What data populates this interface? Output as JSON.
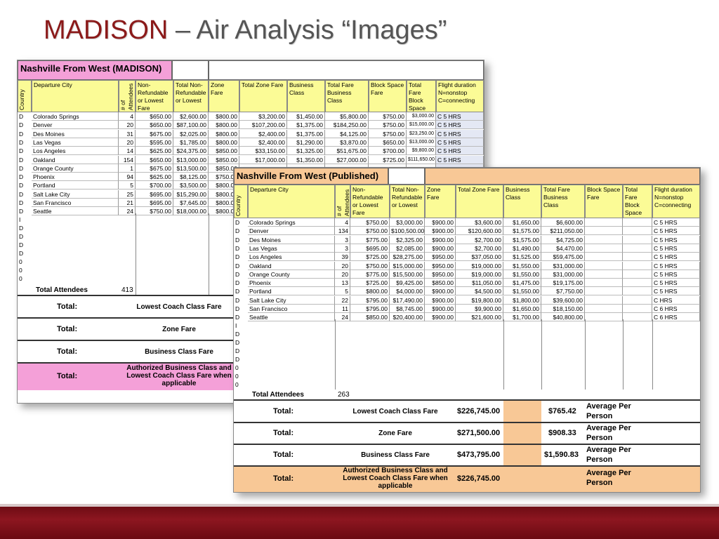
{
  "slide": {
    "title_highlight": "MADISON",
    "title_rest": " – Air Analysis “Images”"
  },
  "colors": {
    "title_red": "#8B1A1A",
    "pink": "#f4a0d8",
    "orange": "#f8c896",
    "yellow": "#fbfb96",
    "bar": "#7a1018"
  },
  "sheet1": {
    "title": "Nashville From West (MADISON)",
    "headers": {
      "country": "Country",
      "departure": "Departure City",
      "attendees": "# of Attendees",
      "nonref": "Non-Refundable or Lowest Fare",
      "total_nonref": "Total Non-Refundable or Lowest",
      "zone": "Zone Fare",
      "total_zone": "Total Zone Fare",
      "business": "Business Class",
      "total_business": "Total Fare Business Class",
      "block": "Block Space Fare",
      "total_block": "Total Fare Block Space",
      "flight": "Flight duration N=nonstop C=connecting"
    },
    "rows": [
      {
        "c": "D",
        "city": "Colorado Springs",
        "att": "4",
        "nr": "$650.00",
        "tnr": "$2,600.00",
        "zf": "$800.00",
        "tzf": "$3,200.00",
        "bc": "$1,450.00",
        "tbc": "$5,800.00",
        "bs": "$750.00",
        "tbs": "$3,000.00",
        "fd": "C 5 HRS"
      },
      {
        "c": "D",
        "city": "Denver",
        "att": "20",
        "nr": "$650.00",
        "tnr": "$87,100.00",
        "zf": "$800.00",
        "tzf": "$107,200.00",
        "bc": "$1,375.00",
        "tbc": "$184,250.00",
        "bs": "$750.00",
        "tbs": "$15,000.00",
        "fd": "C 5 HRS"
      },
      {
        "c": "D",
        "city": "Des Moines",
        "att": "31",
        "nr": "$675.00",
        "tnr": "$2,025.00",
        "zf": "$800.00",
        "tzf": "$2,400.00",
        "bc": "$1,375.00",
        "tbc": "$4,125.00",
        "bs": "$750.00",
        "tbs": "$23,250.00",
        "fd": "C 5 HRS"
      },
      {
        "c": "D",
        "city": "Las Vegas",
        "att": "20",
        "nr": "$595.00",
        "tnr": "$1,785.00",
        "zf": "$800.00",
        "tzf": "$2,400.00",
        "bc": "$1,290.00",
        "tbc": "$3,870.00",
        "bs": "$650.00",
        "tbs": "$13,000.00",
        "fd": "C 5 HRS"
      },
      {
        "c": "D",
        "city": "Los Angeles",
        "att": "14",
        "nr": "$625.00",
        "tnr": "$24,375.00",
        "zf": "$850.00",
        "tzf": "$33,150.00",
        "bc": "$1,325.00",
        "tbc": "$51,675.00",
        "bs": "$700.00",
        "tbs": "$9,800.00",
        "fd": "C 5 HRS"
      },
      {
        "c": "D",
        "city": "Oakland",
        "att": "154",
        "nr": "$650.00",
        "tnr": "$13,000.00",
        "zf": "$850.00",
        "tzf": "$17,000.00",
        "bc": "$1,350.00",
        "tbc": "$27,000.00",
        "bs": "$725.00",
        "tbs": "$111,650.00",
        "fd": "C 5 HRS"
      },
      {
        "c": "D",
        "city": "Orange County",
        "att": "1",
        "nr": "$675.00",
        "tnr": "$13,500.00",
        "zf": "$850.00",
        "tzf": "",
        "bc": "",
        "tbc": "",
        "bs": "",
        "tbs": "",
        "fd": ""
      },
      {
        "c": "D",
        "city": "Phoenix",
        "att": "94",
        "nr": "$625.00",
        "tnr": "$8,125.00",
        "zf": "$750.00",
        "tzf": "",
        "bc": "",
        "tbc": "",
        "bs": "",
        "tbs": "",
        "fd": ""
      },
      {
        "c": "D",
        "city": "Portland",
        "att": "5",
        "nr": "$700.00",
        "tnr": "$3,500.00",
        "zf": "$800.00",
        "tzf": "",
        "bc": "",
        "tbc": "",
        "bs": "",
        "tbs": "",
        "fd": ""
      },
      {
        "c": "D",
        "city": "Salt Lake City",
        "att": "25",
        "nr": "$695.00",
        "tnr": "$15,290.00",
        "zf": "$800.00",
        "tzf": "",
        "bc": "",
        "tbc": "",
        "bs": "",
        "tbs": "",
        "fd": ""
      },
      {
        "c": "D",
        "city": "San Francisco",
        "att": "21",
        "nr": "$695.00",
        "tnr": "$7,645.00",
        "zf": "$800.00",
        "tzf": "",
        "bc": "",
        "tbc": "",
        "bs": "",
        "tbs": "",
        "fd": ""
      },
      {
        "c": "D",
        "city": "Seattle",
        "att": "24",
        "nr": "$750.00",
        "tnr": "$18,000.00",
        "zf": "$800.00",
        "tzf": "",
        "bc": "",
        "tbc": "",
        "bs": "",
        "tbs": "",
        "fd": ""
      }
    ],
    "extra_flags": [
      "I",
      "D",
      "D",
      "D",
      "D",
      "0",
      "0",
      "0"
    ],
    "total_attendees_label": "Total Attendees",
    "total_attendees": "413",
    "totals": [
      {
        "label": "Total:",
        "desc": "Lowest Coach Class Fare"
      },
      {
        "label": "Total:",
        "desc": "Zone Fare"
      },
      {
        "label": "Total:",
        "desc": "Business Class Fare"
      },
      {
        "label": "Total:",
        "desc": "Authorized Business Class and Lowest Coach Class Fare when applicable"
      }
    ]
  },
  "sheet2": {
    "title": "Nashville From West (Published)",
    "headers": {
      "country": "Country",
      "departure": "Departure City",
      "attendees": "# of Attendees",
      "nonref": "Non-Refundable or Lowest Fare",
      "total_nonref": "Total Non-Refundable or Lowest",
      "zone": "Zone Fare",
      "total_zone": "Total Zone Fare",
      "business": "Business Class",
      "total_business": "Total Fare Business Class",
      "block": "Block Space Fare",
      "total_block": "Total Fare Block Space",
      "flight": "Flight duration N=nonstop C=connecting"
    },
    "rows": [
      {
        "c": "D",
        "city": "Colorado Springs",
        "att": "4",
        "nr": "$750.00",
        "tnr": "$3,000.00",
        "zf": "$900.00",
        "tzf": "$3,600.00",
        "bc": "$1,650.00",
        "tbc": "$6,600.00",
        "fd": "C 5 HRS"
      },
      {
        "c": "D",
        "city": "Denver",
        "att": "134",
        "nr": "$750.00",
        "tnr": "$100,500.00",
        "zf": "$900.00",
        "tzf": "$120,600.00",
        "bc": "$1,575.00",
        "tbc": "$211,050.00",
        "fd": "C 5 HRS"
      },
      {
        "c": "D",
        "city": "Des Moines",
        "att": "3",
        "nr": "$775.00",
        "tnr": "$2,325.00",
        "zf": "$900.00",
        "tzf": "$2,700.00",
        "bc": "$1,575.00",
        "tbc": "$4,725.00",
        "fd": "C 5 HRS"
      },
      {
        "c": "D",
        "city": "Las Vegas",
        "att": "3",
        "nr": "$695.00",
        "tnr": "$2,085.00",
        "zf": "$900.00",
        "tzf": "$2,700.00",
        "bc": "$1,490.00",
        "tbc": "$4,470.00",
        "fd": "C 5 HRS"
      },
      {
        "c": "D",
        "city": "Los Angeles",
        "att": "39",
        "nr": "$725.00",
        "tnr": "$28,275.00",
        "zf": "$950.00",
        "tzf": "$37,050.00",
        "bc": "$1,525.00",
        "tbc": "$59,475.00",
        "fd": "C 5 HRS"
      },
      {
        "c": "D",
        "city": "Oakland",
        "att": "20",
        "nr": "$750.00",
        "tnr": "$15,000.00",
        "zf": "$950.00",
        "tzf": "$19,000.00",
        "bc": "$1,550.00",
        "tbc": "$31,000.00",
        "fd": "C 5 HRS"
      },
      {
        "c": "D",
        "city": "Orange County",
        "att": "20",
        "nr": "$775.00",
        "tnr": "$15,500.00",
        "zf": "$950.00",
        "tzf": "$19,000.00",
        "bc": "$1,550.00",
        "tbc": "$31,000.00",
        "fd": "C 5 HRS"
      },
      {
        "c": "D",
        "city": "Phoenix",
        "att": "13",
        "nr": "$725.00",
        "tnr": "$9,425.00",
        "zf": "$850.00",
        "tzf": "$11,050.00",
        "bc": "$1,475.00",
        "tbc": "$19,175.00",
        "fd": "C 5 HRS"
      },
      {
        "c": "D",
        "city": "Portland",
        "att": "5",
        "nr": "$800.00",
        "tnr": "$4,000.00",
        "zf": "$900.00",
        "tzf": "$4,500.00",
        "bc": "$1,550.00",
        "tbc": "$7,750.00",
        "fd": "C 5 HRS"
      },
      {
        "c": "D",
        "city": "Salt Lake City",
        "att": "22",
        "nr": "$795.00",
        "tnr": "$17,490.00",
        "zf": "$900.00",
        "tzf": "$19,800.00",
        "bc": "$1,800.00",
        "tbc": "$39,600.00",
        "fd": "C HRS"
      },
      {
        "c": "D",
        "city": "San Francisco",
        "att": "11",
        "nr": "$795.00",
        "tnr": "$8,745.00",
        "zf": "$900.00",
        "tzf": "$9,900.00",
        "bc": "$1,650.00",
        "tbc": "$18,150.00",
        "fd": "C 6 HRS"
      },
      {
        "c": "D",
        "city": "Seattle",
        "att": "24",
        "nr": "$850.00",
        "tnr": "$20,400.00",
        "zf": "$900.00",
        "tzf": "$21,600.00",
        "bc": "$1,700.00",
        "tbc": "$40,800.00",
        "fd": "C 6 HRS"
      }
    ],
    "extra_flags": [
      "I",
      "D",
      "D",
      "D",
      "D",
      "0",
      "0",
      "0"
    ],
    "total_attendees_label": "Total Attendees",
    "total_attendees": "263",
    "totals": [
      {
        "label": "Total:",
        "desc": "Lowest Coach Class Fare",
        "value": "$226,745.00",
        "avg": "$765.42",
        "avg_label": "Average Per Person"
      },
      {
        "label": "Total:",
        "desc": "Zone Fare",
        "value": "$271,500.00",
        "avg": "$908.33",
        "avg_label": "Average Per Person"
      },
      {
        "label": "Total:",
        "desc": "Business Class Fare",
        "value": "$473,795.00",
        "avg": "$1,590.83",
        "avg_label": "Average Per Person"
      },
      {
        "label": "Total:",
        "desc": "Authorized Business Class and Lowest Coach Class Fare when applicable",
        "value": "$226,745.00",
        "avg": "",
        "avg_label": "Average Per Person"
      }
    ]
  }
}
